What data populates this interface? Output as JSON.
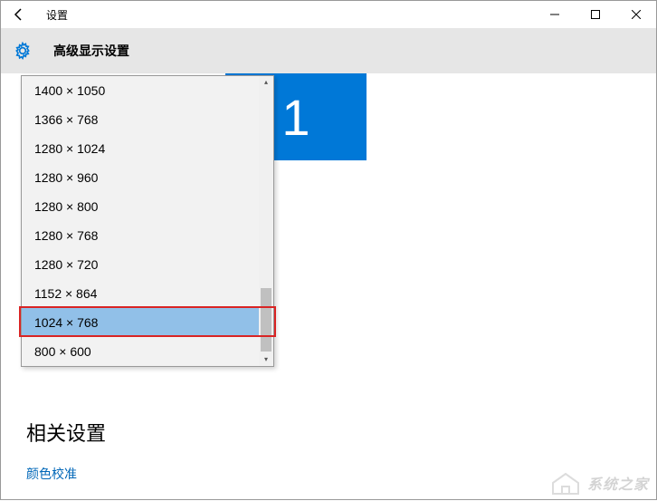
{
  "titlebar": {
    "title": "设置"
  },
  "subheader": {
    "title": "高级显示设置"
  },
  "monitor": {
    "number": "1"
  },
  "resolution_dropdown": {
    "options": [
      "1400 × 1050",
      "1366 × 768",
      "1280 × 1024",
      "1280 × 960",
      "1280 × 800",
      "1280 × 768",
      "1280 × 720",
      "1152 × 864",
      "1024 × 768",
      "800 × 600"
    ],
    "selected_index": 8
  },
  "related": {
    "heading": "相关设置",
    "links": [
      "颜色校准"
    ]
  },
  "watermark": {
    "text": "系统之家"
  }
}
